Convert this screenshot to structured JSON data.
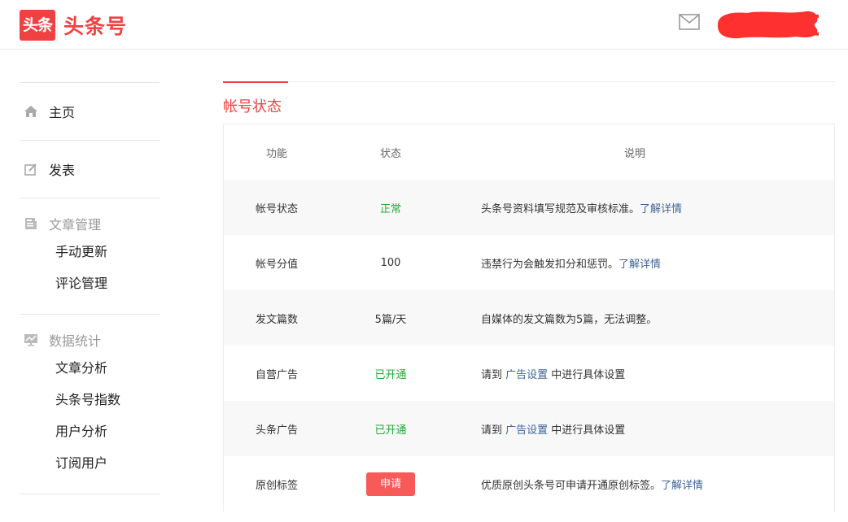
{
  "header": {
    "logo_badge": "头条",
    "logo_text": "头条号",
    "mail_icon": "mail-icon",
    "user_name": "",
    "colors": {
      "brand": "#f04142",
      "redaction": "#ff3030"
    }
  },
  "sidebar": {
    "home": {
      "icon": "home-icon",
      "label": "主页"
    },
    "publish": {
      "icon": "edit-icon",
      "label": "发表"
    },
    "articles": {
      "icon": "document-icon",
      "label": "文章管理",
      "items": [
        {
          "label": "手动更新"
        },
        {
          "label": "评论管理"
        }
      ]
    },
    "stats": {
      "icon": "chart-icon",
      "label": "数据统计",
      "items": [
        {
          "label": "文章分析"
        },
        {
          "label": "头条号指数"
        },
        {
          "label": "用户分析"
        },
        {
          "label": "订阅用户"
        }
      ]
    }
  },
  "main": {
    "tab_title": "帐号状态",
    "table": {
      "headers": {
        "feature": "功能",
        "status": "状态",
        "desc": "说明"
      },
      "rows": [
        {
          "feature": "帐号状态",
          "status": "正常",
          "desc_pre": "头条号资料填写规范及审核标准。",
          "link": "了解详情",
          "desc_post": ""
        },
        {
          "feature": "帐号分值",
          "status": "100",
          "desc_pre": "违禁行为会触发扣分和惩罚。",
          "link": "了解详情",
          "desc_post": ""
        },
        {
          "feature": "发文篇数",
          "status": "5篇/天",
          "desc_pre": "自媒体的发文篇数为5篇，无法调整。",
          "link": "",
          "desc_post": ""
        },
        {
          "feature": "自营广告",
          "status": "已开通",
          "desc_pre": "请到 ",
          "link": "广告设置",
          "desc_post": " 中进行具体设置"
        },
        {
          "feature": "头条广告",
          "status": "已开通",
          "desc_pre": "请到 ",
          "link": "广告设置",
          "desc_post": " 中进行具体设置"
        },
        {
          "feature": "原创标签",
          "status": "申请",
          "desc_pre": "优质原创头条号可申请开通原创标签。",
          "link": "了解详情",
          "desc_post": ""
        }
      ]
    }
  }
}
